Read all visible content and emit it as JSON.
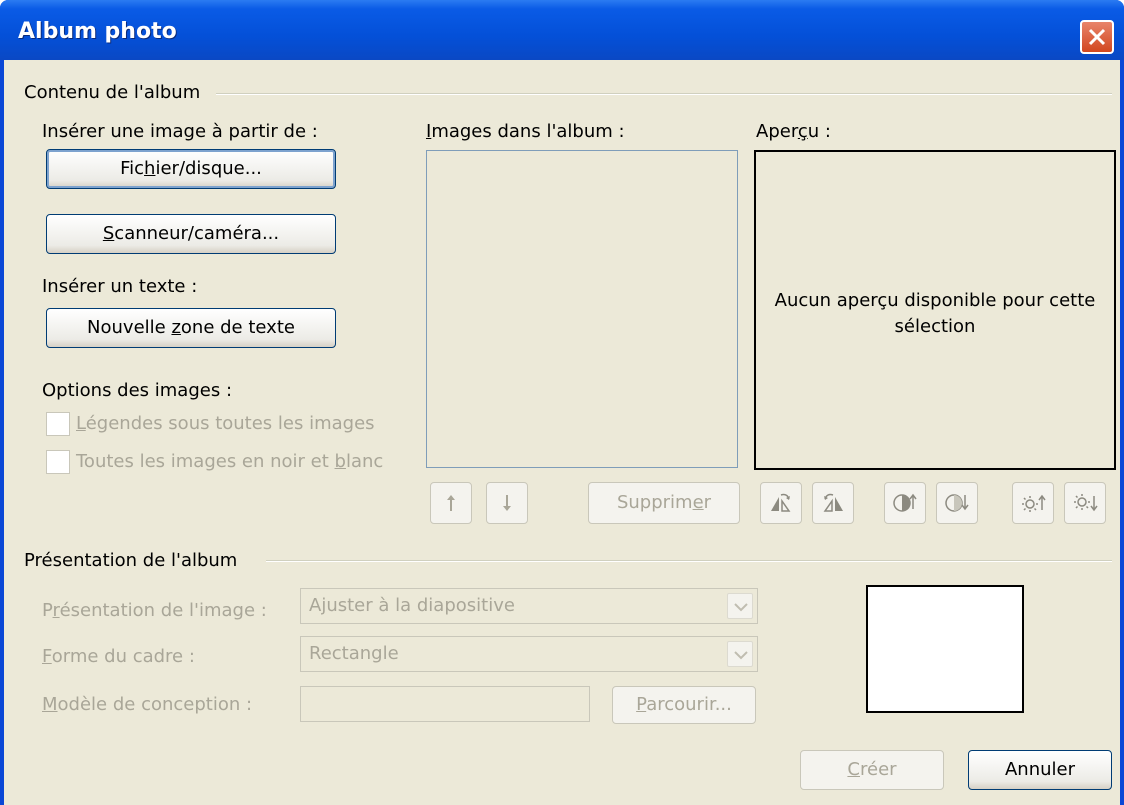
{
  "window": {
    "title": "Album photo"
  },
  "content_group": {
    "label": "Contenu de l'album"
  },
  "insert_image": {
    "label": "Insérer une image à partir de :",
    "file_button": {
      "pre": "Fic",
      "key": "h",
      "post": "ier/disque..."
    },
    "scanner_button": {
      "pre": "",
      "key": "S",
      "post": "canneur/caméra..."
    }
  },
  "insert_text": {
    "label": "Insérer un texte :",
    "new_textbox_button": {
      "pre": "Nouvelle ",
      "key": "z",
      "post": "one de texte"
    }
  },
  "image_options": {
    "label": "Options des images :",
    "captions": {
      "pre": "",
      "key": "L",
      "post": "égendes sous toutes les images"
    },
    "black_white": {
      "pre": "Toutes les images en noir et ",
      "key": "b",
      "post": "lanc"
    }
  },
  "images_list": {
    "label_pre": "",
    "label_key": "I",
    "label_post": "mages dans l'album :"
  },
  "remove_button": {
    "pre": "Supprim",
    "key": "e",
    "post": "r"
  },
  "preview": {
    "label_pre": "Aper",
    "label_key": "ç",
    "label_post": "u :",
    "message_line1": "Aucun aperçu disponible pour cette",
    "message_line2": "sélection"
  },
  "layout_group": {
    "label": "Présentation de l'album"
  },
  "picture_layout": {
    "label_pre": "P",
    "label_key": "r",
    "label_post": "ésentation de l'image :",
    "value": "Ajuster à la diapositive"
  },
  "frame_shape": {
    "label_pre": "",
    "label_key": "F",
    "label_post": "orme du cadre :",
    "value": "Rectangle"
  },
  "theme": {
    "label_pre": "",
    "label_key": "M",
    "label_post": "odèle de conception :",
    "value": "",
    "browse_button": {
      "pre": "",
      "key": "P",
      "post": "arcourir..."
    }
  },
  "footer": {
    "create_button": {
      "pre": "",
      "key": "C",
      "post": "réer"
    },
    "cancel_button": "Annuler"
  },
  "colors": {
    "title_bar": "#0450d8",
    "dialog_bg": "#ece9d8",
    "disabled_text": "#a9a698"
  }
}
